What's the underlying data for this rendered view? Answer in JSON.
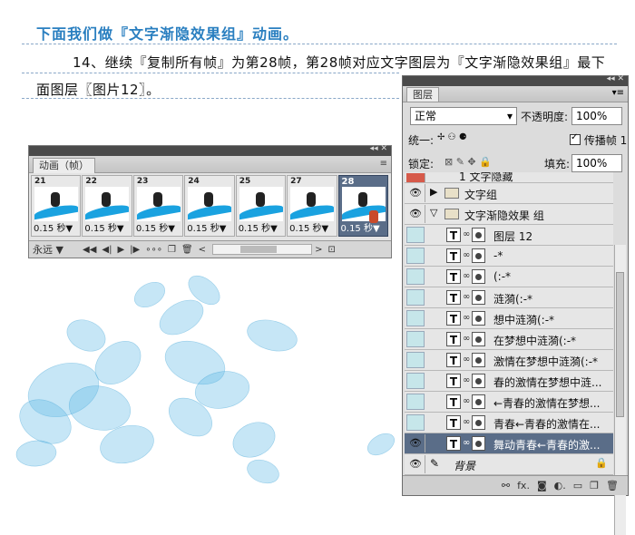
{
  "doc": {
    "title": "下面我们做『文字渐隐效果组』动画。",
    "line1": "14、继续『复制所有帧』为第28帧，第28帧对应文字图层为『文字渐隐效果组』最下",
    "line2": "面图层〖图片12〗。"
  },
  "animation_panel": {
    "tab": "动画（帧）",
    "menu_icon": "≡",
    "frames": [
      {
        "num": "21",
        "delay": "0.15 秒▼"
      },
      {
        "num": "22",
        "delay": "0.15 秒▼"
      },
      {
        "num": "23",
        "delay": "0.15 秒▼"
      },
      {
        "num": "24",
        "delay": "0.15 秒▼"
      },
      {
        "num": "25",
        "delay": "0.15 秒▼"
      },
      {
        "num": "27",
        "delay": "0.15 秒▼"
      },
      {
        "num": "28",
        "delay": "0.15 秒▼"
      }
    ],
    "selected_frame": "28",
    "loop": "永远",
    "loop_arrow": "▼"
  },
  "layers_panel": {
    "tab": "图层",
    "blend_mode": "正常",
    "opacity_label": "不透明度:",
    "opacity_value": "100%",
    "unify_label": "统一:",
    "propagate_label": "传播帧 1",
    "lock_label": "锁定:",
    "fill_label": "填充:",
    "fill_value": "100%",
    "top_partial": "1 文字隐藏",
    "groups": [
      {
        "name": "文字组",
        "expanded": false
      },
      {
        "name": "文字渐隐效果 组",
        "expanded": true
      }
    ],
    "layers": [
      {
        "name": "图层 12",
        "visible": false
      },
      {
        "name": "-*",
        "visible": false
      },
      {
        "name": "(:-*",
        "visible": false
      },
      {
        "name": "涟漪(:-*",
        "visible": false
      },
      {
        "name": "想中涟漪(:-*",
        "visible": false
      },
      {
        "name": "在梦想中涟漪(:-*",
        "visible": false
      },
      {
        "name": "激情在梦想中涟漪(:-*",
        "visible": false
      },
      {
        "name": "春的激情在梦想中涟...",
        "visible": false
      },
      {
        "name": "←青春的激情在梦想...",
        "visible": false
      },
      {
        "name": "青春←青春的激情在...",
        "visible": false
      },
      {
        "name": "舞动青春←青春的激...",
        "visible": true,
        "selected": true
      }
    ],
    "background_layer": "背景",
    "bottom_icons": [
      "link-icon",
      "fx-icon",
      "mask-icon",
      "adjustment-icon",
      "folder-icon",
      "new-layer-icon",
      "trash-icon"
    ]
  },
  "colors": {
    "title": "#2a7fc0",
    "selection": "#5a6d88",
    "panel_bg": "#dcdcdc"
  }
}
